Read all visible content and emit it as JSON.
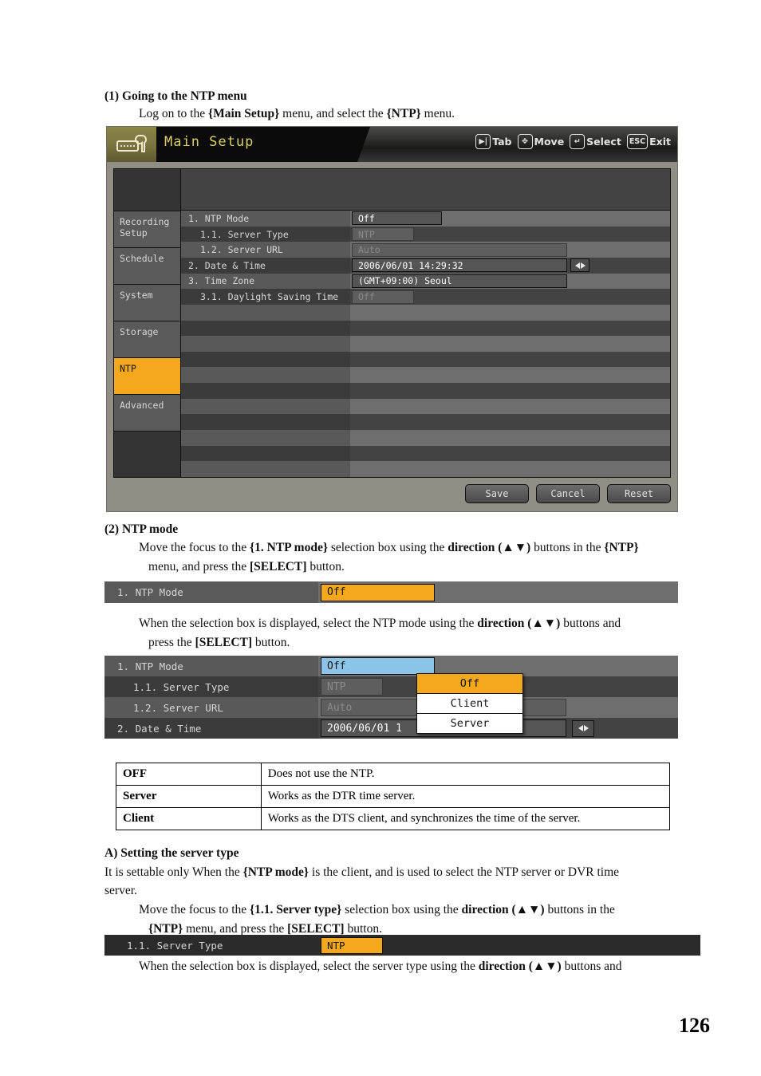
{
  "page": {
    "number": "126"
  },
  "section1": {
    "heading": "(1)  Going to the NTP menu",
    "line1_a": "Log on to the ",
    "line1_b": "{Main Setup}",
    "line1_c": " menu, and select the ",
    "line1_d": "{NTP}",
    "line1_e": " menu."
  },
  "dvr": {
    "title": "Main Setup",
    "title_icon": "dvr-wrench-icon",
    "hints": [
      {
        "key": "▶|",
        "label": "Tab",
        "icon": "tab-icon"
      },
      {
        "key": "✥",
        "label": "Move",
        "icon": "dpad-icon"
      },
      {
        "key": "↺",
        "label": "Select",
        "icon": "enter-icon"
      },
      {
        "key": "ESC",
        "label": "Exit",
        "icon": "esc-icon"
      }
    ],
    "sidebar": [
      {
        "label": "Recording Setup",
        "active": false
      },
      {
        "label": "Schedule",
        "active": false
      },
      {
        "label": "System",
        "active": false
      },
      {
        "label": "Storage",
        "active": false
      },
      {
        "label": "NTP",
        "active": true
      },
      {
        "label": "Advanced",
        "active": false
      }
    ],
    "rows": [
      {
        "label": "1. NTP Mode",
        "value": "Off",
        "box": "w-md",
        "state": "normal",
        "arrows": false
      },
      {
        "label": "1.1. Server Type",
        "value": "NTP",
        "box": "w-sm",
        "state": "disabled",
        "arrows": false
      },
      {
        "label": "1.2. Server URL",
        "value": "Auto",
        "box": "w-lg",
        "state": "disabled",
        "arrows": false
      },
      {
        "label": "2. Date & Time",
        "value": "2006/06/01    14:29:32",
        "box": "w-lg",
        "state": "normal",
        "arrows": true
      },
      {
        "label": "3. Time Zone",
        "value": "(GMT+09:00) Seoul",
        "box": "w-lg",
        "state": "normal",
        "arrows": false
      },
      {
        "label": "3.1. Daylight Saving Time",
        "value": "Off",
        "box": "w-sm",
        "state": "disabled",
        "arrows": false
      }
    ],
    "buttons": [
      {
        "label": "Save"
      },
      {
        "label": "Cancel"
      },
      {
        "label": "Reset"
      }
    ],
    "accent_orange": "#f5a81c",
    "accent_blue": "#8cc4e8"
  },
  "section2": {
    "heading": "(2)  NTP mode",
    "p1_a": "Move the focus to the ",
    "p1_b": "{1. NTP mode}",
    "p1_c": " selection box using the ",
    "p1_d": "direction (▲▼)",
    "p1_e": " buttons in the ",
    "p1_f": "{NTP}",
    "p2_a": "menu, and press the ",
    "p2_b": "[SELECT]",
    "p2_c": " button.",
    "strip": {
      "label": "1. NTP Mode",
      "value": "Off"
    },
    "p3_a": "When the selection box is displayed, select the NTP mode using the ",
    "p3_b": "direction (▲▼)",
    "p3_c": " buttons and",
    "p4_a": "press the ",
    "p4_b": "[SELECT]",
    "p4_c": " button."
  },
  "dropdown_shot": {
    "rows": [
      {
        "label": "1. NTP Mode",
        "value": "Off",
        "box": "w-md",
        "state": "blue"
      },
      {
        "label": "1.1. Server Type",
        "value": "NTP",
        "box": "w-sm",
        "state": "disabled"
      },
      {
        "label": "1.2. Server URL",
        "value": "Auto",
        "box": "w-lg",
        "state": "disabled"
      },
      {
        "label": "2. Date & Time",
        "value": "2006/06/01   1",
        "box": "w-lg",
        "state": "normal"
      }
    ],
    "options": [
      {
        "label": "Off",
        "selected": true
      },
      {
        "label": "Client",
        "selected": false
      },
      {
        "label": "Server",
        "selected": false
      }
    ]
  },
  "desc_table": {
    "rows": [
      {
        "key": "OFF",
        "value": "Does not use the NTP."
      },
      {
        "key": "Server",
        "value": "Works as the DTR time server."
      },
      {
        "key": "Client",
        "value": "Works as the DTS client, and synchronizes the time of the server."
      }
    ]
  },
  "sectionA": {
    "heading": "A) Setting the server type",
    "p1_a": "It is settable only When the ",
    "p1_b": "{NTP mode}",
    "p1_c": " is the client, and is used to select the NTP server or DVR time",
    "p2": "server.",
    "p3_a": "Move the focus to the ",
    "p3_b": "{1.1. Server type}",
    "p3_c": " selection box using the ",
    "p3_d": "direction (▲▼)",
    "p3_e": " buttons in the",
    "p4_a": "{NTP}",
    "p4_b": " menu, and press the ",
    "p4_c": "[SELECT]",
    "p4_d": " button.",
    "strip": {
      "label": "1.1. Server Type",
      "value": "NTP"
    },
    "p5_a": "When the selection box is displayed, select the server type using the ",
    "p5_b": "direction (▲▼)",
    "p5_c": " buttons and"
  }
}
